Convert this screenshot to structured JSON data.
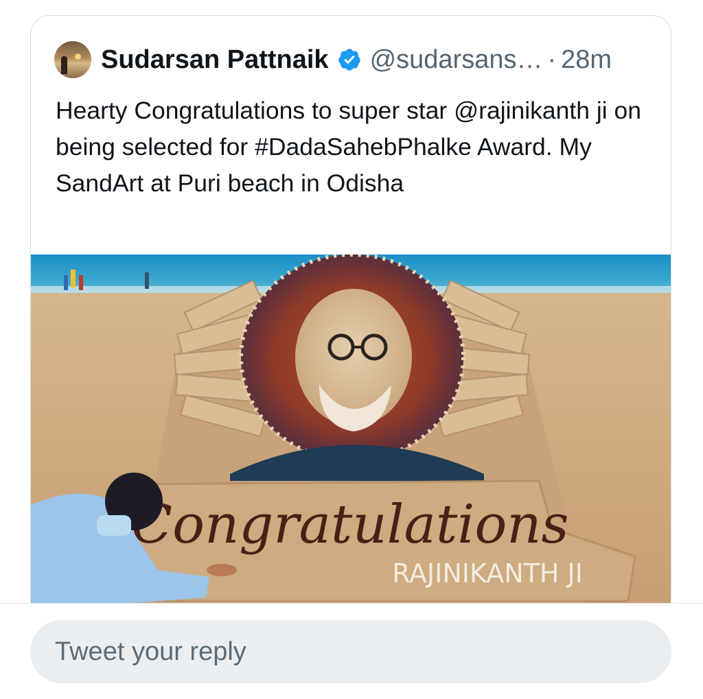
{
  "tweet": {
    "display_name": "Sudarsan Pattnaik",
    "handle": "@sudarsans…",
    "separator": "·",
    "time": "28m",
    "text": "Hearty Congratulations to super star @rajinikanth ji on being selected for #DadaSahebPhalke Award. My SandArt at Puri beach in Odisha",
    "avatar_icon": "avatar-photo",
    "verified_icon": "verified-badge-icon",
    "verified_color": "#1d9bf0",
    "media": {
      "sign_text": "Congratulations",
      "sign_subtext": "RAJINIKANTH JI"
    }
  },
  "reply": {
    "placeholder": "Tweet your reply"
  },
  "colors": {
    "text_primary": "#0f1419",
    "text_secondary": "#536471",
    "reply_bg": "#ebeef0"
  }
}
